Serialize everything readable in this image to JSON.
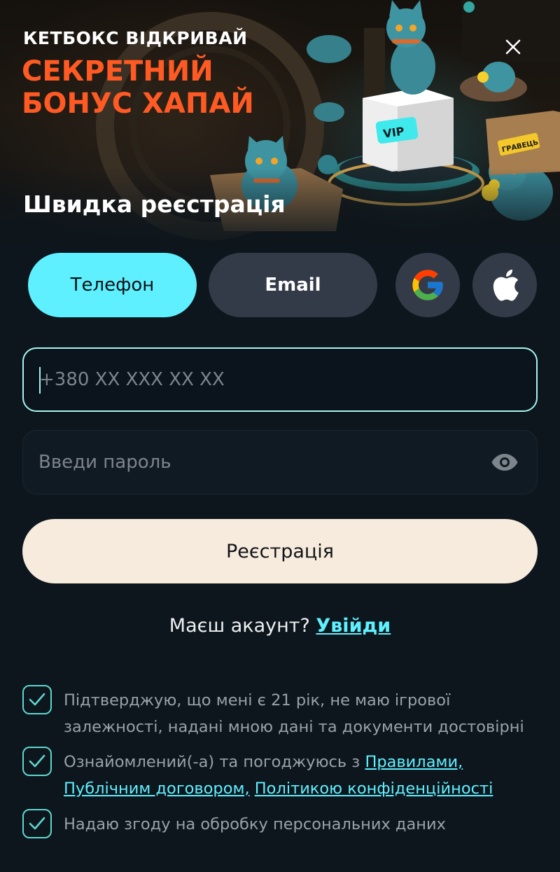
{
  "banner": {
    "line1": "КЕТБОКС ВІДКРИВАЙ",
    "line2": "СЕКРЕТНИЙ",
    "line3": "БОНУС ХАПАЙ",
    "vip_label": "VIP",
    "box_label": "ГРАВЕЦЬ",
    "accent_color": "#ff5a23"
  },
  "title": "Швидка реєстрація",
  "tabs": {
    "phone": "Телефон",
    "email": "Email",
    "active": "phone",
    "active_color": "#5ff0ff"
  },
  "social": {
    "google_icon": "google-icon",
    "apple_icon": "apple-icon"
  },
  "form": {
    "phone_placeholder": "+380 XX XXX XX XX",
    "password_placeholder": "Введи пароль",
    "register_label": "Реєстрація"
  },
  "login": {
    "prompt": "Маєш акаунт? ",
    "link": "Увійди"
  },
  "consents": {
    "c1_text": "Підтверджую, що мені є 21 рік, не маю ігрової залежності, надані мною дані та документи достовірні",
    "c2_prefix": "Ознайомлений(-а) та погоджуюсь з ",
    "c2_link1": "Правилами,",
    "c2_link2": "Публічним договором,",
    "c2_link3": "Політикою конфіденційності",
    "c3_text": "Надаю згоду на обробку персональних даних",
    "all_checked": true
  }
}
